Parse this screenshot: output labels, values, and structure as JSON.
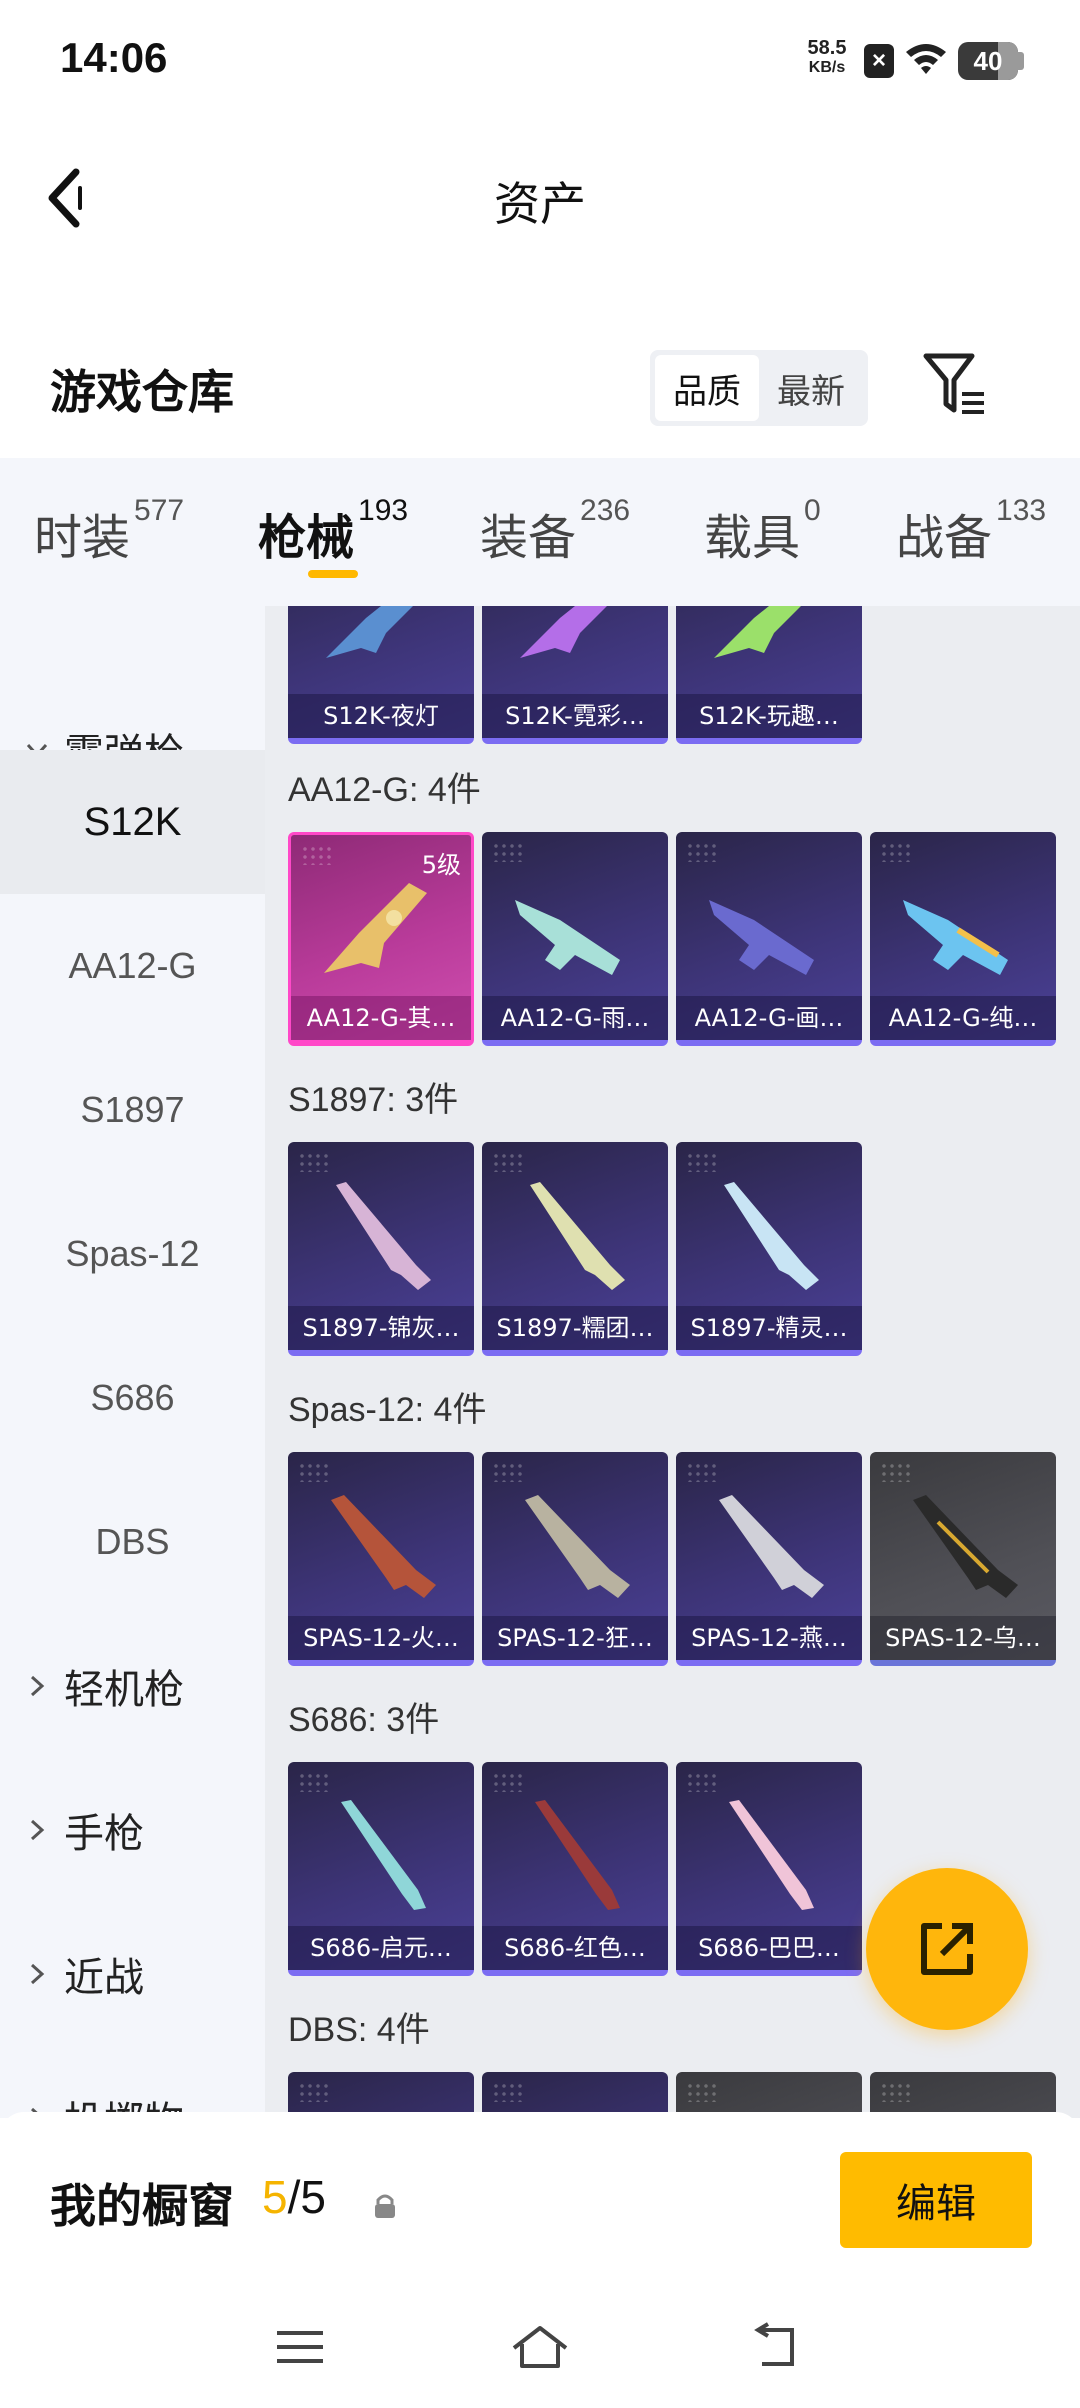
{
  "status_bar": {
    "time": "14:06",
    "net_speed_value": "58.5",
    "net_speed_unit": "KB/s",
    "x_badge": "×",
    "battery": "40",
    "battery_level": 0.4
  },
  "header": {
    "title": "资产",
    "back_icon": "chevron-left-icon"
  },
  "section": {
    "title": "游戏仓库",
    "sort_options": [
      "品质",
      "最新"
    ],
    "sort_active": "品质",
    "filter_icon": "filter-icon"
  },
  "tabs": [
    {
      "label": "时装",
      "count": "577",
      "active": false
    },
    {
      "label": "枪械",
      "count": "193",
      "active": true
    },
    {
      "label": "装备",
      "count": "236",
      "active": false
    },
    {
      "label": "载具",
      "count": "0",
      "active": false
    },
    {
      "label": "战备",
      "count": "133",
      "active": false
    }
  ],
  "sidebar": {
    "group_open": "霰弹枪",
    "items": [
      "S12K",
      "AA12-G",
      "S1897",
      "Spas-12",
      "S686",
      "DBS"
    ],
    "active_item": "S12K",
    "collapsed_groups": [
      "轻机枪",
      "手枪",
      "近战",
      "投掷物"
    ]
  },
  "content": {
    "top_row": [
      "S12K-夜灯",
      "S12K-霓彩…",
      "S12K-玩趣…"
    ],
    "groups": [
      {
        "label": "AA12-G: 4件",
        "items": [
          {
            "name": "AA12-G-其…",
            "style": "pink",
            "level": "5级"
          },
          {
            "name": "AA12-G-雨…",
            "style": "purple"
          },
          {
            "name": "AA12-G-画…",
            "style": "purple"
          },
          {
            "name": "AA12-G-纯…",
            "style": "purple"
          }
        ]
      },
      {
        "label": "S1897: 3件",
        "items": [
          {
            "name": "S1897-锦灰…",
            "style": "purple"
          },
          {
            "name": "S1897-糯团…",
            "style": "purple"
          },
          {
            "name": "S1897-精灵…",
            "style": "purple"
          }
        ]
      },
      {
        "label": "Spas-12: 4件",
        "items": [
          {
            "name": "SPAS-12-火…",
            "style": "purple"
          },
          {
            "name": "SPAS-12-狂…",
            "style": "purple"
          },
          {
            "name": "SPAS-12-燕…",
            "style": "purple"
          },
          {
            "name": "SPAS-12-乌…",
            "style": "grey"
          }
        ]
      },
      {
        "label": "S686: 3件",
        "items": [
          {
            "name": "S686-启元…",
            "style": "purple"
          },
          {
            "name": "S686-红色…",
            "style": "purple"
          },
          {
            "name": "S686-巴巴…",
            "style": "purple"
          }
        ]
      },
      {
        "label": "DBS: 4件",
        "items": []
      }
    ]
  },
  "fab_icon": "share-edit-icon",
  "bottom_bar": {
    "label": "我的橱窗",
    "current": "5",
    "separator": "/",
    "max": "5",
    "edit_label": "编辑"
  },
  "nav": [
    "menu-icon",
    "home-icon",
    "back-icon"
  ],
  "colors": {
    "accent": "#ffb800",
    "rare_pink": "#ff48c8",
    "card_purple": "#3d3477"
  }
}
